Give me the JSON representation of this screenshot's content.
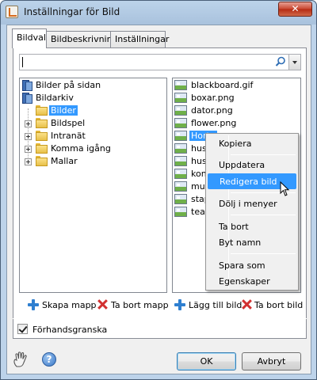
{
  "window": {
    "title": "Inställningar för Bild",
    "close_label": "✕"
  },
  "tabs": [
    {
      "label": "Bildval",
      "active": true
    },
    {
      "label": "Bildbeskrivning",
      "active": false
    },
    {
      "label": "Inställningar",
      "active": false
    }
  ],
  "search": {
    "value": "",
    "placeholder": ""
  },
  "tree": {
    "items": [
      {
        "label": "Bilder på sidan",
        "icon": "book-icon"
      },
      {
        "label": "Bildarkiv",
        "icon": "book-icon"
      },
      {
        "label": "Bilder",
        "icon": "folder-icon",
        "selected": true
      },
      {
        "label": "Bildspel",
        "icon": "folder-icon"
      },
      {
        "label": "Intranät",
        "icon": "folder-icon"
      },
      {
        "label": "Komma igång",
        "icon": "folder-icon"
      },
      {
        "label": "Mallar",
        "icon": "folder-icon"
      }
    ]
  },
  "files": {
    "items": [
      {
        "label": "blackboard.gif"
      },
      {
        "label": "boxar.png"
      },
      {
        "label": "dator.png"
      },
      {
        "label": "flower.png"
      },
      {
        "label": "Horte",
        "selected": true
      },
      {
        "label": "hus_"
      },
      {
        "label": "hus.p"
      },
      {
        "label": "kon_"
      },
      {
        "label": "mus."
      },
      {
        "label": "stapl"
      },
      {
        "label": "teac"
      }
    ]
  },
  "actions": {
    "create_folder": "Skapa mapp",
    "delete_folder": "Ta bort mapp",
    "add_image": "Lägg till bild",
    "delete_image": "Ta bort bild"
  },
  "preview": {
    "label": "Förhandsgranska",
    "checked": true
  },
  "buttons": {
    "ok": "OK",
    "cancel": "Avbryt",
    "help": "?"
  },
  "context_menu": {
    "copy": "Kopiera",
    "refresh": "Uppdatera",
    "edit_image": "Redigera bild",
    "hide_in_menus": "Dölj i menyer",
    "delete": "Ta bort",
    "rename": "Byt namn",
    "save_as": "Spara som",
    "properties": "Egenskaper"
  }
}
